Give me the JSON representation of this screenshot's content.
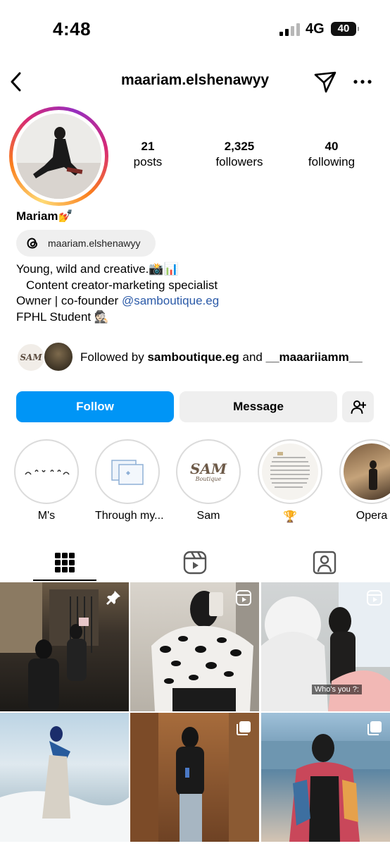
{
  "status_bar": {
    "time": "4:48",
    "network": "4G",
    "battery": "40",
    "signal_bars_active": 2
  },
  "header": {
    "username": "maariam.elshenawyy",
    "back_icon": "chevron-left-icon",
    "send_icon": "paper-plane-icon",
    "more_icon": "more-horizontal-icon"
  },
  "profile": {
    "stats": [
      {
        "value": "21",
        "label": "posts"
      },
      {
        "value": "2,325",
        "label": "followers"
      },
      {
        "value": "40",
        "label": "following"
      }
    ],
    "display_name": "Mariam💅",
    "threads_handle": "maariam.elshenawyy",
    "bio": {
      "line1": "Young, wild and creative.📸📊",
      "line2": "Content creator-marketing specialist",
      "line3_prefix": "Owner | co-founder ",
      "line3_link": "@samboutique.eg",
      "line4": "FPHL Student 🕵🏻"
    },
    "followed_by": {
      "prefix": "Followed by ",
      "user1": "samboutique.eg",
      "middle": " and ",
      "user2": "__maaariiamm__",
      "avatar1_text": "SAM"
    }
  },
  "actions": {
    "follow": "Follow",
    "message": "Message",
    "add_user_icon": "add-user-icon"
  },
  "highlights": [
    {
      "label": "M's"
    },
    {
      "label": "Through my..."
    },
    {
      "label": "Sam",
      "cover_text": "SAM",
      "cover_sub": "Boutique"
    },
    {
      "label": "🏆"
    },
    {
      "label": "Opera"
    }
  ],
  "tabs": [
    {
      "name": "grid-icon",
      "active": true
    },
    {
      "name": "reels-icon",
      "active": false
    },
    {
      "name": "tagged-icon",
      "active": false
    }
  ],
  "grid": {
    "caption_cell3": "Who's you ?:",
    "pinned_icon": "pin-icon",
    "reel_icon": "reel-badge-icon",
    "multi_icon": "carousel-icon"
  },
  "colors": {
    "accent": "#0095f6",
    "link": "#2b5aa8",
    "button_gray": "#efefef"
  }
}
